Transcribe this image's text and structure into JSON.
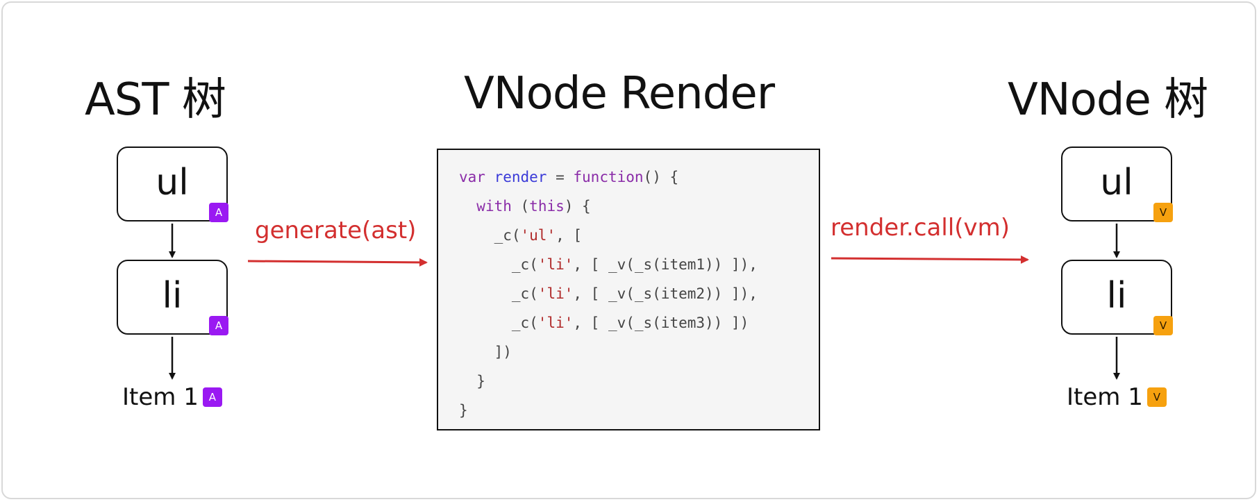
{
  "titles": {
    "ast": "AST 树",
    "render": "VNode Render",
    "vnode": "VNode 树"
  },
  "ast_tree": {
    "nodes": [
      {
        "label": "ul",
        "badge": "A"
      },
      {
        "label": "li",
        "badge": "A"
      }
    ],
    "item": {
      "label": "Item 1",
      "badge": "A"
    }
  },
  "vnode_tree": {
    "nodes": [
      {
        "label": "ul",
        "badge": "V"
      },
      {
        "label": "li",
        "badge": "V"
      }
    ],
    "item": {
      "label": "Item 1",
      "badge": "V"
    }
  },
  "arrows": {
    "generate": "generate(ast)",
    "render_call": "render.call(vm)"
  },
  "code": {
    "lines": [
      "var render = function() {",
      "  with (this) {",
      "    _c('ul', [",
      "      _c('li', [ _v(_s(item1)) ]),",
      "      _c('li', [ _v(_s(item2)) ]),",
      "      _c('li', [ _v(_s(item3)) ])",
      "    ])",
      "  }",
      "}"
    ]
  },
  "colors": {
    "ast_badge": "#9a19f2",
    "vnode_badge": "#f6a10f",
    "arrow": "#d32f2f",
    "code_bg": "#f5f5f5"
  }
}
